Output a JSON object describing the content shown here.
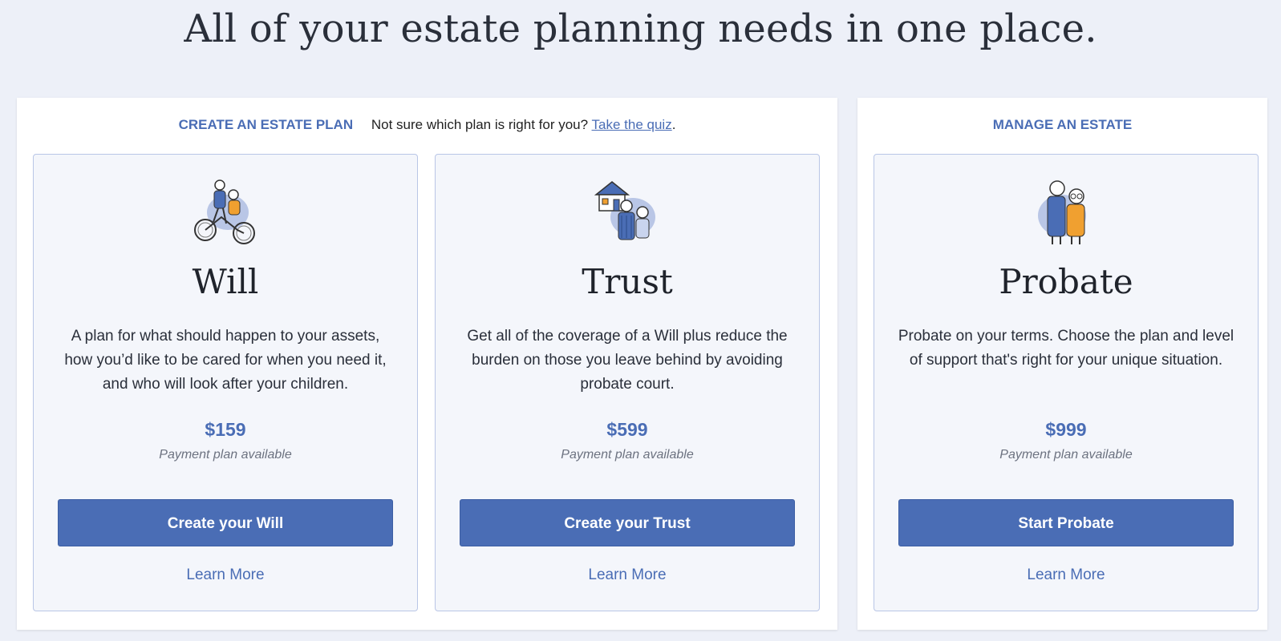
{
  "page": {
    "headline": "All of your estate planning needs in one place."
  },
  "create_section": {
    "label": "CREATE AN ESTATE PLAN",
    "quiz_prompt": "Not sure which plan is right for you?",
    "quiz_link": "Take the quiz",
    "quiz_suffix": "."
  },
  "manage_section": {
    "label": "MANAGE AN ESTATE"
  },
  "cards": [
    {
      "icon": "couple-on-bicycles-illustration",
      "title": "Will",
      "description": "A plan for what should happen to your assets, how you’d like to be cared for when you need it, and who will look after your children.",
      "price": "$159",
      "payment_note": "Payment plan available",
      "cta": "Create your Will",
      "learn_more": "Learn More"
    },
    {
      "icon": "couple-with-house-illustration",
      "title": "Trust",
      "description": "Get all of the coverage of a Will plus reduce the burden on those you leave behind by avoiding probate court.",
      "price": "$599",
      "payment_note": "Payment plan available",
      "cta": "Create your Trust",
      "learn_more": "Learn More"
    },
    {
      "icon": "elderly-couple-illustration",
      "title": "Probate",
      "description": "Probate on your terms. Choose the plan and level of support that's right for your unique situation.",
      "price": "$999",
      "payment_note": "Payment plan available",
      "cta": "Start Probate",
      "learn_more": "Learn More"
    }
  ],
  "colors": {
    "accent": "#4a6db5",
    "page_background": "#edf0f8",
    "card_background": "#f4f6fb",
    "card_border": "#b9c6e6"
  }
}
